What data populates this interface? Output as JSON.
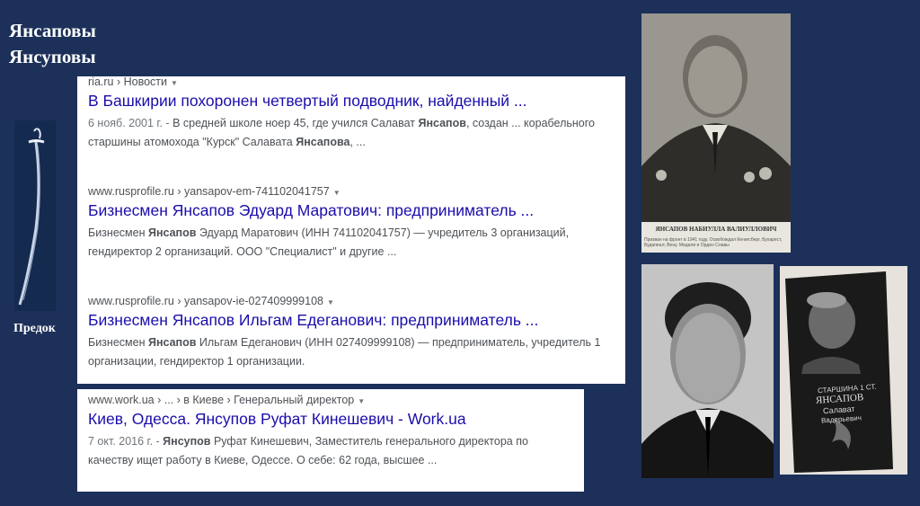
{
  "heading": {
    "line1": "Янсаповы",
    "line2": "Янсуповы"
  },
  "ancestor_label": "Предок",
  "results": [
    {
      "source": "ria.ru",
      "path": "› Новости",
      "title": "В Башкирии похоронен четвертый подводник, найденный ...",
      "snippet": [
        {
          "t": "6 нояб. 2001 г. - ",
          "c": "date"
        },
        {
          "t": "В средней школе ноер 45, где учился Салават "
        },
        {
          "t": "Янсапов",
          "c": "b"
        },
        {
          "t": ", создан ... корабельного старшины атомохода \"Курск\" Салавата "
        },
        {
          "t": "Янсапова",
          "c": "b"
        },
        {
          "t": ", ..."
        }
      ]
    },
    {
      "source": "www.rusprofile.ru",
      "path": "› yansapov-em-741102041757",
      "title": "Бизнесмен Янсапов Эдуард Маратович: предприниматель ...",
      "snippet": [
        {
          "t": "Бизнесмен "
        },
        {
          "t": "Янсапов",
          "c": "b"
        },
        {
          "t": " Эдуард Маратович (ИНН 741102041757) — учредитель 3 организаций, гендиректор 2 организаций. ООО \"Специалист\" и другие ..."
        }
      ]
    },
    {
      "source": "www.rusprofile.ru",
      "path": "› yansapov-ie-027409999108",
      "title": "Бизнесмен Янсапов Ильгам Едеганович: предприниматель ...",
      "snippet": [
        {
          "t": "Бизнесмен "
        },
        {
          "t": "Янсапов",
          "c": "b"
        },
        {
          "t": " Ильгам Едеганович (ИНН 027409999108) — предприниматель, учредитель 1 организации, гендиректор 1 организации."
        }
      ]
    },
    {
      "source": "www.work.ua",
      "path": "› ... › в Киеве › Генеральный директор",
      "title": "Киев, Одесса. Янсупов Руфат Кинешевич - Work.ua",
      "snippet": [
        {
          "t": "7 окт. 2016 г. - ",
          "c": "date"
        },
        {
          "t": "Янсупов",
          "c": "b"
        },
        {
          "t": " Руфат Кинешевич, Заместитель генерального директора по качеству ищет работу в Киеве, Одессе. О себе: 62 года, высшее ..."
        }
      ]
    }
  ],
  "photos": {
    "portrait_caption": "ЯНСАПОВ НАБИУЛЛА ВАЛИУЛЛОВИЧ",
    "portrait_subcaption": "Призван на фронт в 1941 году. Освобождал Кенигсберг, Бухарест, Будапешт, Вену. Медали и Орден Славы",
    "memorial_line1": "СТАРШИНА 1 СТ.",
    "memorial_line2": "ЯНСАПОВ",
    "memorial_line3": "Салават",
    "memorial_line4": "Вадерьевич"
  }
}
